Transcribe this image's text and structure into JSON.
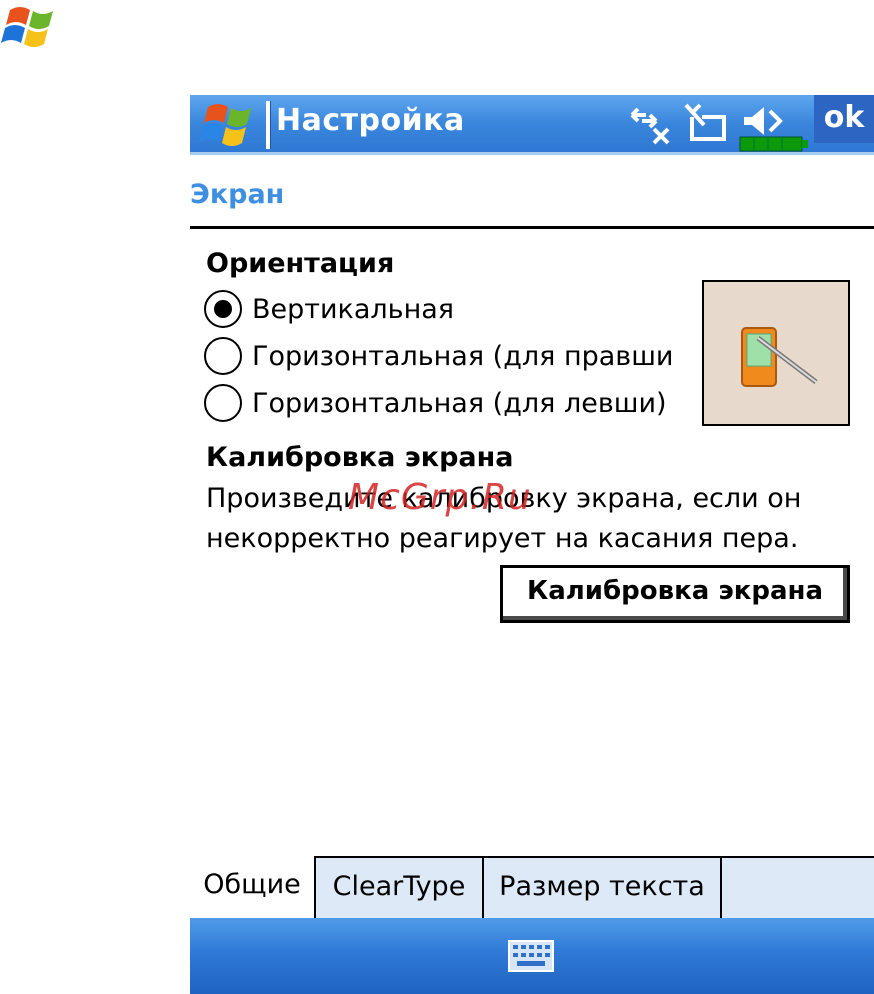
{
  "app": {
    "title": "Настройка",
    "ok_label": "ok"
  },
  "icons": {
    "corner_logo": "windows-flag-icon",
    "start": "windows-flag-icon",
    "connectivity": "connectivity-off-icon",
    "sync": "no-sync-icon",
    "volume": "volume-muted-icon",
    "battery": "battery-icon",
    "preview": "pda-stylus-icon",
    "keyboard": "keyboard-icon"
  },
  "section": {
    "title": "Экран"
  },
  "orientation": {
    "heading": "Ориентация",
    "options": [
      {
        "label": "Вертикальная",
        "checked": true
      },
      {
        "label": "Горизонтальная (для правши",
        "checked": false
      },
      {
        "label": "Горизонтальная (для левши)",
        "checked": false
      }
    ]
  },
  "calibration": {
    "heading": "Калибровка экрана",
    "description_line1": "Произведите калибровку экрана, если он",
    "description_line2": "некорректно реагирует на касания пера.",
    "button_label": "Калибровка экрана"
  },
  "watermark": "McGrp.Ru",
  "tabs": [
    {
      "label": "Общие",
      "active": true
    },
    {
      "label": "ClearType",
      "active": false
    },
    {
      "label": "Размер текста",
      "active": false
    }
  ],
  "colors": {
    "titlebar": "#3a86dc",
    "section_title": "#3f8fe0",
    "watermark": "#d42424",
    "tab_bg": "#dde9f7",
    "preview_bg": "#e7d9cc"
  }
}
